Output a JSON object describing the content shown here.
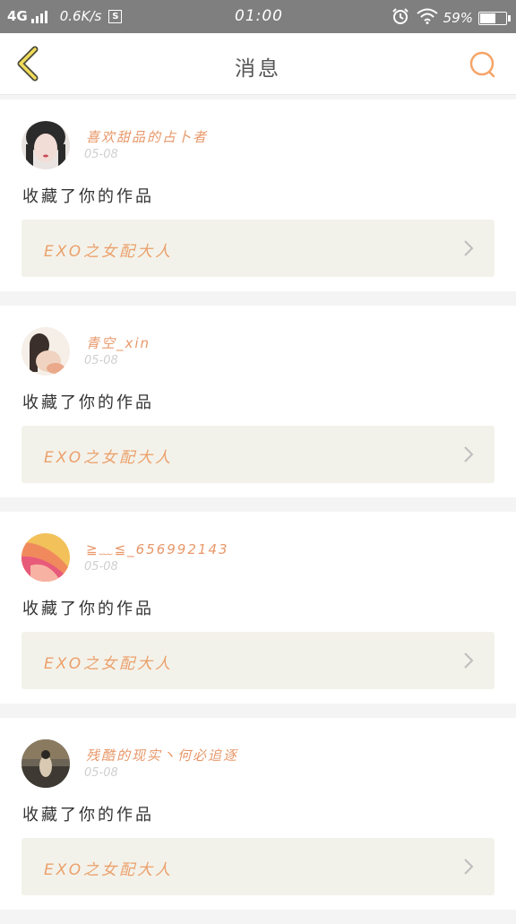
{
  "status_bar": {
    "network": "4G",
    "speed": "0.6K/s",
    "s_badge": "S",
    "time": "01:00",
    "battery_pct": "59%",
    "battery_level": 0.59,
    "icons": [
      "signal-icon",
      "alarm-icon",
      "wifi-icon",
      "battery-icon"
    ]
  },
  "header": {
    "title": "消息",
    "back_icon": "chevron-left-icon",
    "search_icon": "search-icon",
    "accent_color": "#f0b65a"
  },
  "messages": [
    {
      "user": "喜欢甜品的占卜者",
      "date": "05-08",
      "text": "收藏了你的作品",
      "work_title": "EXO之女配大人",
      "avatar_colors": [
        "#2b2b2b",
        "#f2ddd6"
      ]
    },
    {
      "user": "青空_xin",
      "date": "05-08",
      "text": "收藏了你的作品",
      "work_title": "EXO之女配大人",
      "avatar_colors": [
        "#3a2f2b",
        "#f6efe8"
      ]
    },
    {
      "user": "≧﹏≦_656992143",
      "date": "05-08",
      "text": "收藏了你的作品",
      "work_title": "EXO之女配大人",
      "avatar_colors": [
        "#f2c15a",
        "#e85a7a"
      ]
    },
    {
      "user": "残酷的现实丶何必追逐",
      "date": "05-08",
      "text": "收藏了你的作品",
      "work_title": "EXO之女配大人",
      "avatar_colors": [
        "#3e3a33",
        "#8a7a60"
      ]
    }
  ],
  "colors": {
    "name_color": "#e8986a",
    "work_title_color": "#eba06b",
    "work_box_bg": "#f3f2ea",
    "status_bar_bg": "#7f7f7f"
  }
}
